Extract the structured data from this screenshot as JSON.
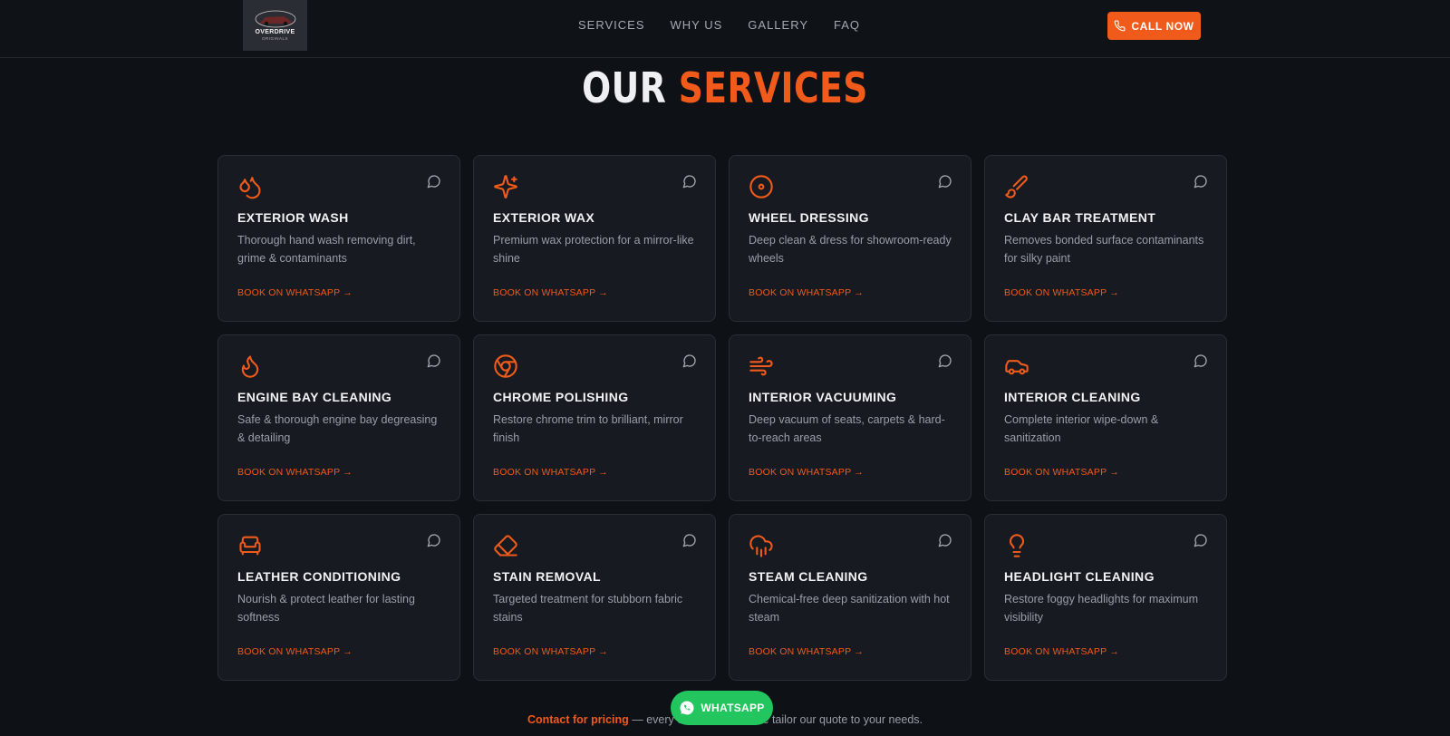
{
  "brand": {
    "logo_name": "OVERDRIVE",
    "logo_sub": "ORIGINALS"
  },
  "nav": {
    "links": [
      "SERVICES",
      "WHY US",
      "GALLERY",
      "FAQ"
    ],
    "call_label": "CALL NOW"
  },
  "section": {
    "title_part1": "OUR",
    "title_part2": "SERVICES"
  },
  "colors": {
    "accent": "#f05a1a",
    "whatsapp": "#22c55e",
    "background": "#0e1116",
    "card": "#171a20"
  },
  "services": [
    {
      "icon": "droplets-icon",
      "title": "EXTERIOR WASH",
      "desc": "Thorough hand wash removing dirt, grime & contaminants",
      "link": "BOOK ON WHATSAPP →"
    },
    {
      "icon": "sparkles-icon",
      "title": "EXTERIOR WAX",
      "desc": "Premium wax protection for a mirror-like shine",
      "link": "BOOK ON WHATSAPP →"
    },
    {
      "icon": "disc-icon",
      "title": "WHEEL DRESSING",
      "desc": "Deep clean & dress for showroom-ready wheels",
      "link": "BOOK ON WHATSAPP →"
    },
    {
      "icon": "brush-icon",
      "title": "CLAY BAR TREATMENT",
      "desc": "Removes bonded surface contaminants for silky paint",
      "link": "BOOK ON WHATSAPP →"
    },
    {
      "icon": "flame-icon",
      "title": "ENGINE BAY CLEANING",
      "desc": "Safe & thorough engine bay degreasing & detailing",
      "link": "BOOK ON WHATSAPP →"
    },
    {
      "icon": "chrome-icon",
      "title": "CHROME POLISHING",
      "desc": "Restore chrome trim to brilliant, mirror finish",
      "link": "BOOK ON WHATSAPP →"
    },
    {
      "icon": "wind-icon",
      "title": "INTERIOR VACUUMING",
      "desc": "Deep vacuum of seats, carpets & hard-to-reach areas",
      "link": "BOOK ON WHATSAPP →"
    },
    {
      "icon": "car-icon",
      "title": "INTERIOR CLEANING",
      "desc": "Complete interior wipe-down & sanitization",
      "link": "BOOK ON WHATSAPP →"
    },
    {
      "icon": "armchair-icon",
      "title": "LEATHER CONDITIONING",
      "desc": "Nourish & protect leather for lasting softness",
      "link": "BOOK ON WHATSAPP →"
    },
    {
      "icon": "eraser-icon",
      "title": "STAIN REMOVAL",
      "desc": "Targeted treatment for stubborn fabric stains",
      "link": "BOOK ON WHATSAPP →"
    },
    {
      "icon": "cloud-rain-icon",
      "title": "STEAM CLEANING",
      "desc": "Chemical-free deep sanitization with hot steam",
      "link": "BOOK ON WHATSAPP →"
    },
    {
      "icon": "lightbulb-icon",
      "title": "HEADLIGHT CLEANING",
      "desc": "Restore foggy headlights for maximum visibility",
      "link": "BOOK ON WHATSAPP →"
    }
  ],
  "footer": {
    "pricing_accent": "Contact for pricing",
    "pricing_text": " — every car is different, we tailor our quote to your needs.",
    "whatsapp_label": "WHATSAPP"
  }
}
